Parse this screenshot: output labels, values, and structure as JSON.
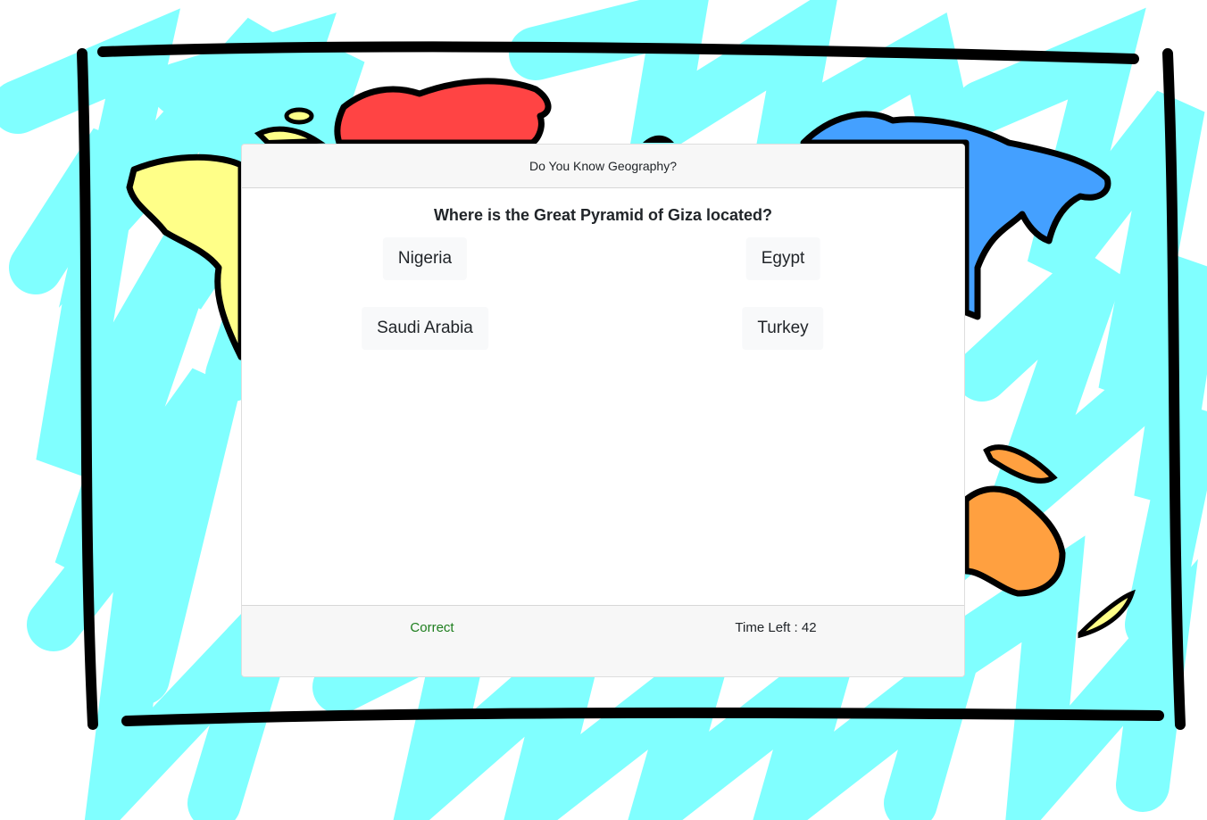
{
  "quiz": {
    "title": "Do You Know Geography?",
    "question": "Where is the Great Pyramid of Giza located?",
    "answers": [
      "Nigeria",
      "Egypt",
      "Saudi Arabia",
      "Turkey"
    ]
  },
  "footer": {
    "result": "Correct",
    "time_label": "Time Left : 42"
  },
  "colors": {
    "water": "#80ffff",
    "north_america": "#ffff88",
    "europe": "#ff4444",
    "asia": "#44a0ff",
    "australia": "#ffa040",
    "result_text": "#1e7e1e"
  }
}
